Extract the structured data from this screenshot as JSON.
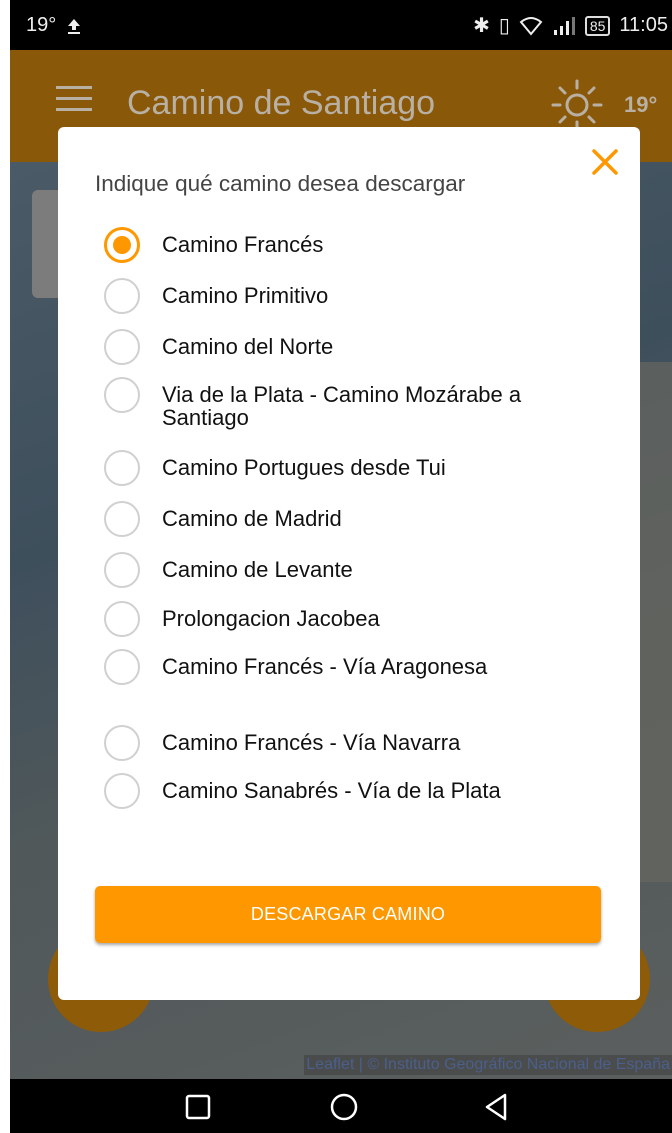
{
  "status_bar": {
    "left_temp": "19°",
    "upload_icon": "upload-arrow-icon",
    "battery": "85",
    "time": "11:05"
  },
  "app_bar": {
    "title": "Camino de Santiago",
    "weather_icon": "sun-icon",
    "temperature": "19°"
  },
  "map": {
    "attribution": "Leaflet | © Instituto Geográfico Nacional de España"
  },
  "dialog": {
    "heading": "Indique qué camino desea descargar",
    "close_icon": "close-icon",
    "options": [
      {
        "label": "Camino Francés",
        "selected": true
      },
      {
        "label": "Camino Primitivo",
        "selected": false
      },
      {
        "label": "Camino del Norte",
        "selected": false
      },
      {
        "label": "Via de la Plata - Camino Mozárabe a Santiago",
        "selected": false
      },
      {
        "label": "Camino Portugues desde Tui",
        "selected": false
      },
      {
        "label": "Camino de Madrid",
        "selected": false
      },
      {
        "label": "Camino de Levante",
        "selected": false
      },
      {
        "label": "Prolongacion Jacobea",
        "selected": false
      },
      {
        "label": "Camino Francés - Vía Aragonesa",
        "selected": false
      },
      {
        "label": "Camino Francés - Vía Navarra",
        "selected": false
      },
      {
        "label": "Camino Sanabrés - Vía de la Plata",
        "selected": false
      }
    ],
    "download_button": "DESCARGAR CAMINO"
  },
  "colors": {
    "accent": "#ff9800",
    "app_bar_dimmed": "#8a5809"
  }
}
